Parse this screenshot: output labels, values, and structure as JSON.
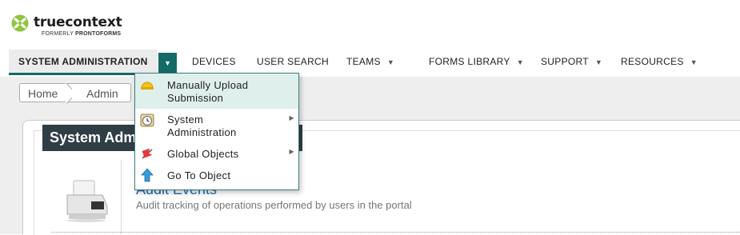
{
  "brand": {
    "name": "truecontext",
    "tagline_prefix": "FORMERLY ",
    "tagline_brand": "PRONTOFORMS"
  },
  "nav": {
    "active": "SYSTEM ADMINISTRATION",
    "items": [
      {
        "label": "DEVICES",
        "dropdown": false
      },
      {
        "label": "USER SEARCH",
        "dropdown": false
      },
      {
        "label": "TEAMS",
        "dropdown": true
      },
      {
        "label": "FORMS LIBRARY",
        "dropdown": true
      },
      {
        "label": "SUPPORT",
        "dropdown": true
      },
      {
        "label": "RESOURCES",
        "dropdown": true
      }
    ],
    "caret": "▼"
  },
  "breadcrumb": [
    "Home",
    "Admin"
  ],
  "panel": {
    "title": "System Administration",
    "item_title": "Audit Events",
    "item_desc": "Audit tracking of operations performed by users in the portal"
  },
  "menu": {
    "items": [
      {
        "label_line1": "Manually Upload",
        "label_line2": "Submission",
        "icon": "hard-hat-icon",
        "submenu": false,
        "highlighted": true
      },
      {
        "label_line1": "System",
        "label_line2": "Administration",
        "icon": "clock-icon",
        "submenu": true,
        "highlighted": false
      },
      {
        "label_line1": "Global Objects",
        "label_line2": "",
        "icon": "flag-icon",
        "submenu": true,
        "highlighted": false
      },
      {
        "label_line1": "Go To Object",
        "label_line2": "",
        "icon": "up-arrow-icon",
        "submenu": false,
        "highlighted": false
      }
    ],
    "submenu_glyph": "▶"
  },
  "colors": {
    "accent": "#136a67",
    "brand_green": "#8dc63f",
    "title_bar": "#2f3d45",
    "link": "#1f6fb5"
  }
}
